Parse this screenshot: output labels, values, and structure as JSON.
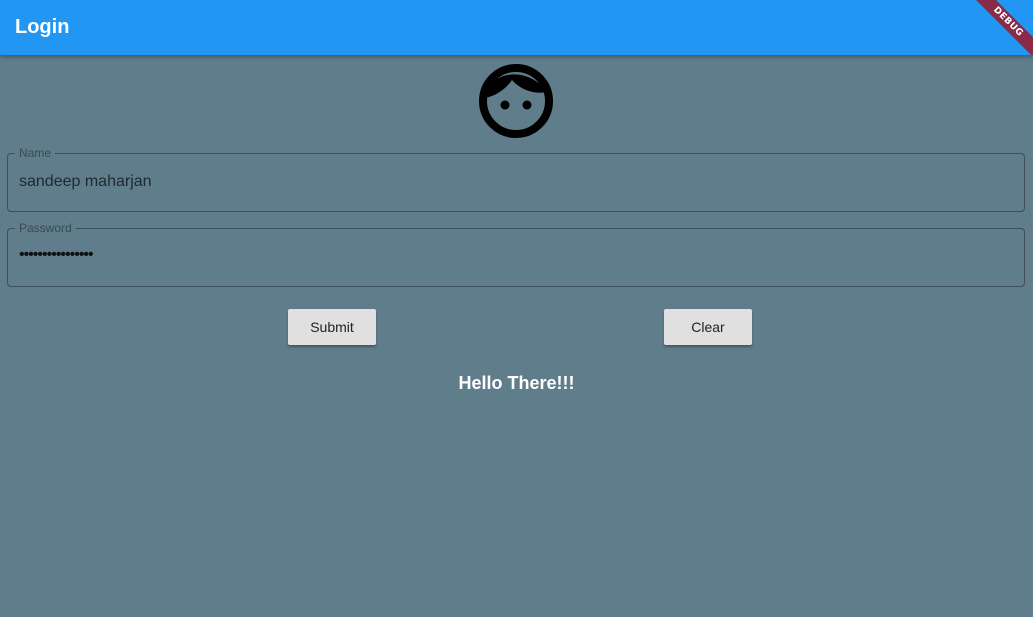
{
  "appbar": {
    "title": "Login",
    "debug_banner": "DEBUG"
  },
  "avatar": {
    "icon": "face-icon"
  },
  "form": {
    "name_field": {
      "label": "Name",
      "value": "sandeep maharjan"
    },
    "password_field": {
      "label": "Password",
      "value": "••••••••••••••••"
    }
  },
  "buttons": {
    "submit_label": "Submit",
    "clear_label": "Clear"
  },
  "greeting": "Hello There!!!",
  "colors": {
    "appbar": "#2196f3",
    "background": "#607d8b",
    "button": "#e0e0e0",
    "debug_banner": "#8b2a47"
  }
}
